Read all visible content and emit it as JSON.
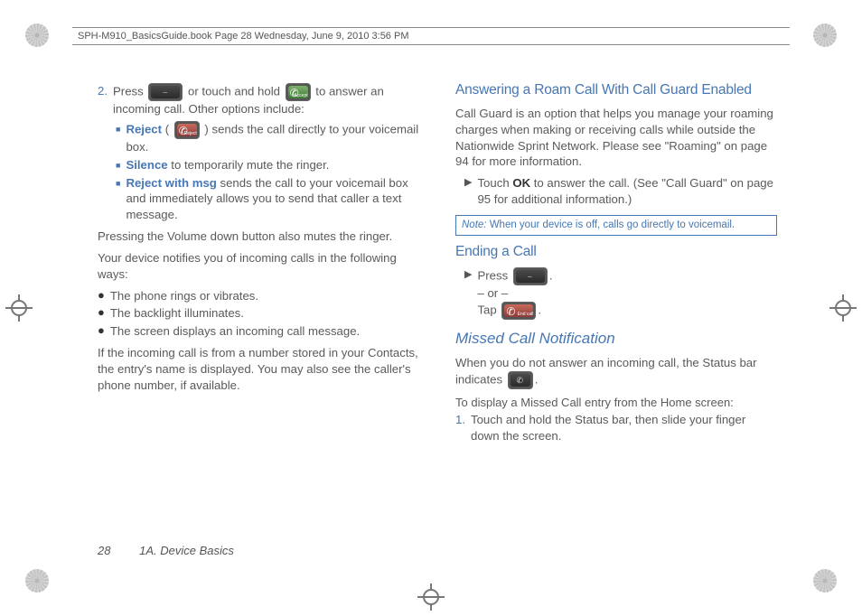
{
  "header": "SPH-M910_BasicsGuide.book  Page 28  Wednesday, June 9, 2010  3:56 PM",
  "left": {
    "step_num": "2.",
    "step2a": "Press ",
    "step2b": " or touch and hold ",
    "step2c": " to answer an incoming call. Other options include:",
    "accept_lbl": "Accept",
    "reject_kw": "Reject",
    "reject_pre": " ( ",
    "reject_post": " ) sends the call directly to your voicemail box.",
    "reject_lbl": "Reject",
    "silence_kw": "Silence",
    "silence_rest": " to temporarily mute the ringer.",
    "rwm_kw": "Reject with msg",
    "rwm_rest": " sends the call to your voicemail box and immediately allows you to send that caller a text message.",
    "vol": "Pressing the Volume down button also mutes the ringer.",
    "notify": "Your device notifies you of incoming calls in the following ways:",
    "b1": "The phone rings or vibrates.",
    "b2": "The backlight illuminates.",
    "b3": "The screen displays an incoming call message.",
    "contacts": "If the incoming call is from a number stored in your Contacts, the entry's name is displayed. You may also see the caller's phone number, if available."
  },
  "right": {
    "h1": "Answering a Roam Call With Call Guard Enabled",
    "cg": "Call Guard is an option that helps you manage your roaming charges when making or receiving calls while outside the Nationwide Sprint Network. Please see \"Roaming\" on page 94 for more information.",
    "touch_pre": "Touch ",
    "ok": "OK",
    "touch_post": " to answer the call. (See \"Call Guard\" on page 95 for additional information.)",
    "note_label": "Note:",
    "note": "  When your device is off, calls go directly to voicemail.",
    "h2": "Ending a Call",
    "press": "Press ",
    "or": "– or –",
    "tap": "Tap ",
    "endcall_lbl": "End call",
    "h3": "Missed Call Notification",
    "missed_pre": "When you do not answer an incoming call, the Status bar indicates ",
    "missed_post": ".",
    "subh": "To display a Missed Call entry from the Home screen:",
    "s1n": "1.",
    "s1": "Touch and hold the Status bar, then slide your finger down the screen."
  },
  "footer": {
    "page": "28",
    "section": "1A. Device Basics"
  }
}
